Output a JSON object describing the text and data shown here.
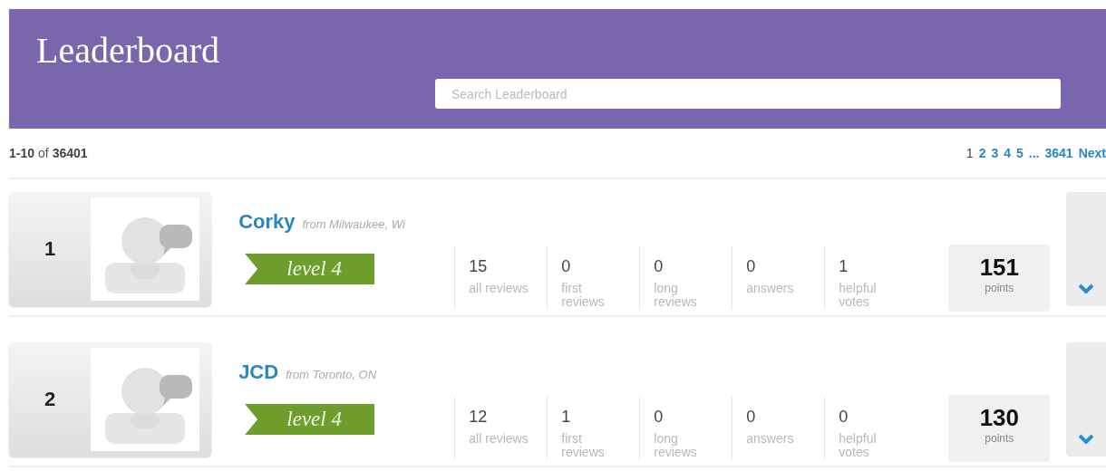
{
  "header": {
    "title": "Leaderboard",
    "search": {
      "placeholder": "Search Leaderboard"
    }
  },
  "summary": {
    "range": "1-10",
    "of": "of",
    "total": "36401"
  },
  "pagination": [
    {
      "label": "1",
      "selected": true
    },
    {
      "label": "2",
      "selected": false
    },
    {
      "label": "3",
      "selected": false
    },
    {
      "label": "4",
      "selected": false
    },
    {
      "label": "5",
      "selected": false
    },
    {
      "label": "...",
      "selected": false
    },
    {
      "label": "3641",
      "selected": false
    },
    {
      "label": "Next",
      "selected": false
    }
  ],
  "rows": [
    {
      "rank": "1",
      "name": "Corky",
      "location": "from Milwaukee, Wi",
      "level": "level 4",
      "stats": [
        {
          "value": "15",
          "label": "all reviews"
        },
        {
          "value": "0",
          "label": "first reviews"
        },
        {
          "value": "0",
          "label": "long reviews"
        },
        {
          "value": "0",
          "label": "answers"
        },
        {
          "value": "1",
          "label": "helpful votes"
        }
      ],
      "points": "151",
      "points_label": "points"
    },
    {
      "rank": "2",
      "name": "JCD",
      "location": "from Toronto, ON",
      "level": "level 4",
      "stats": [
        {
          "value": "12",
          "label": "all reviews"
        },
        {
          "value": "1",
          "label": "first reviews"
        },
        {
          "value": "0",
          "label": "long reviews"
        },
        {
          "value": "0",
          "label": "answers"
        },
        {
          "value": "0",
          "label": "helpful votes"
        }
      ],
      "points": "130",
      "points_label": "points"
    }
  ]
}
